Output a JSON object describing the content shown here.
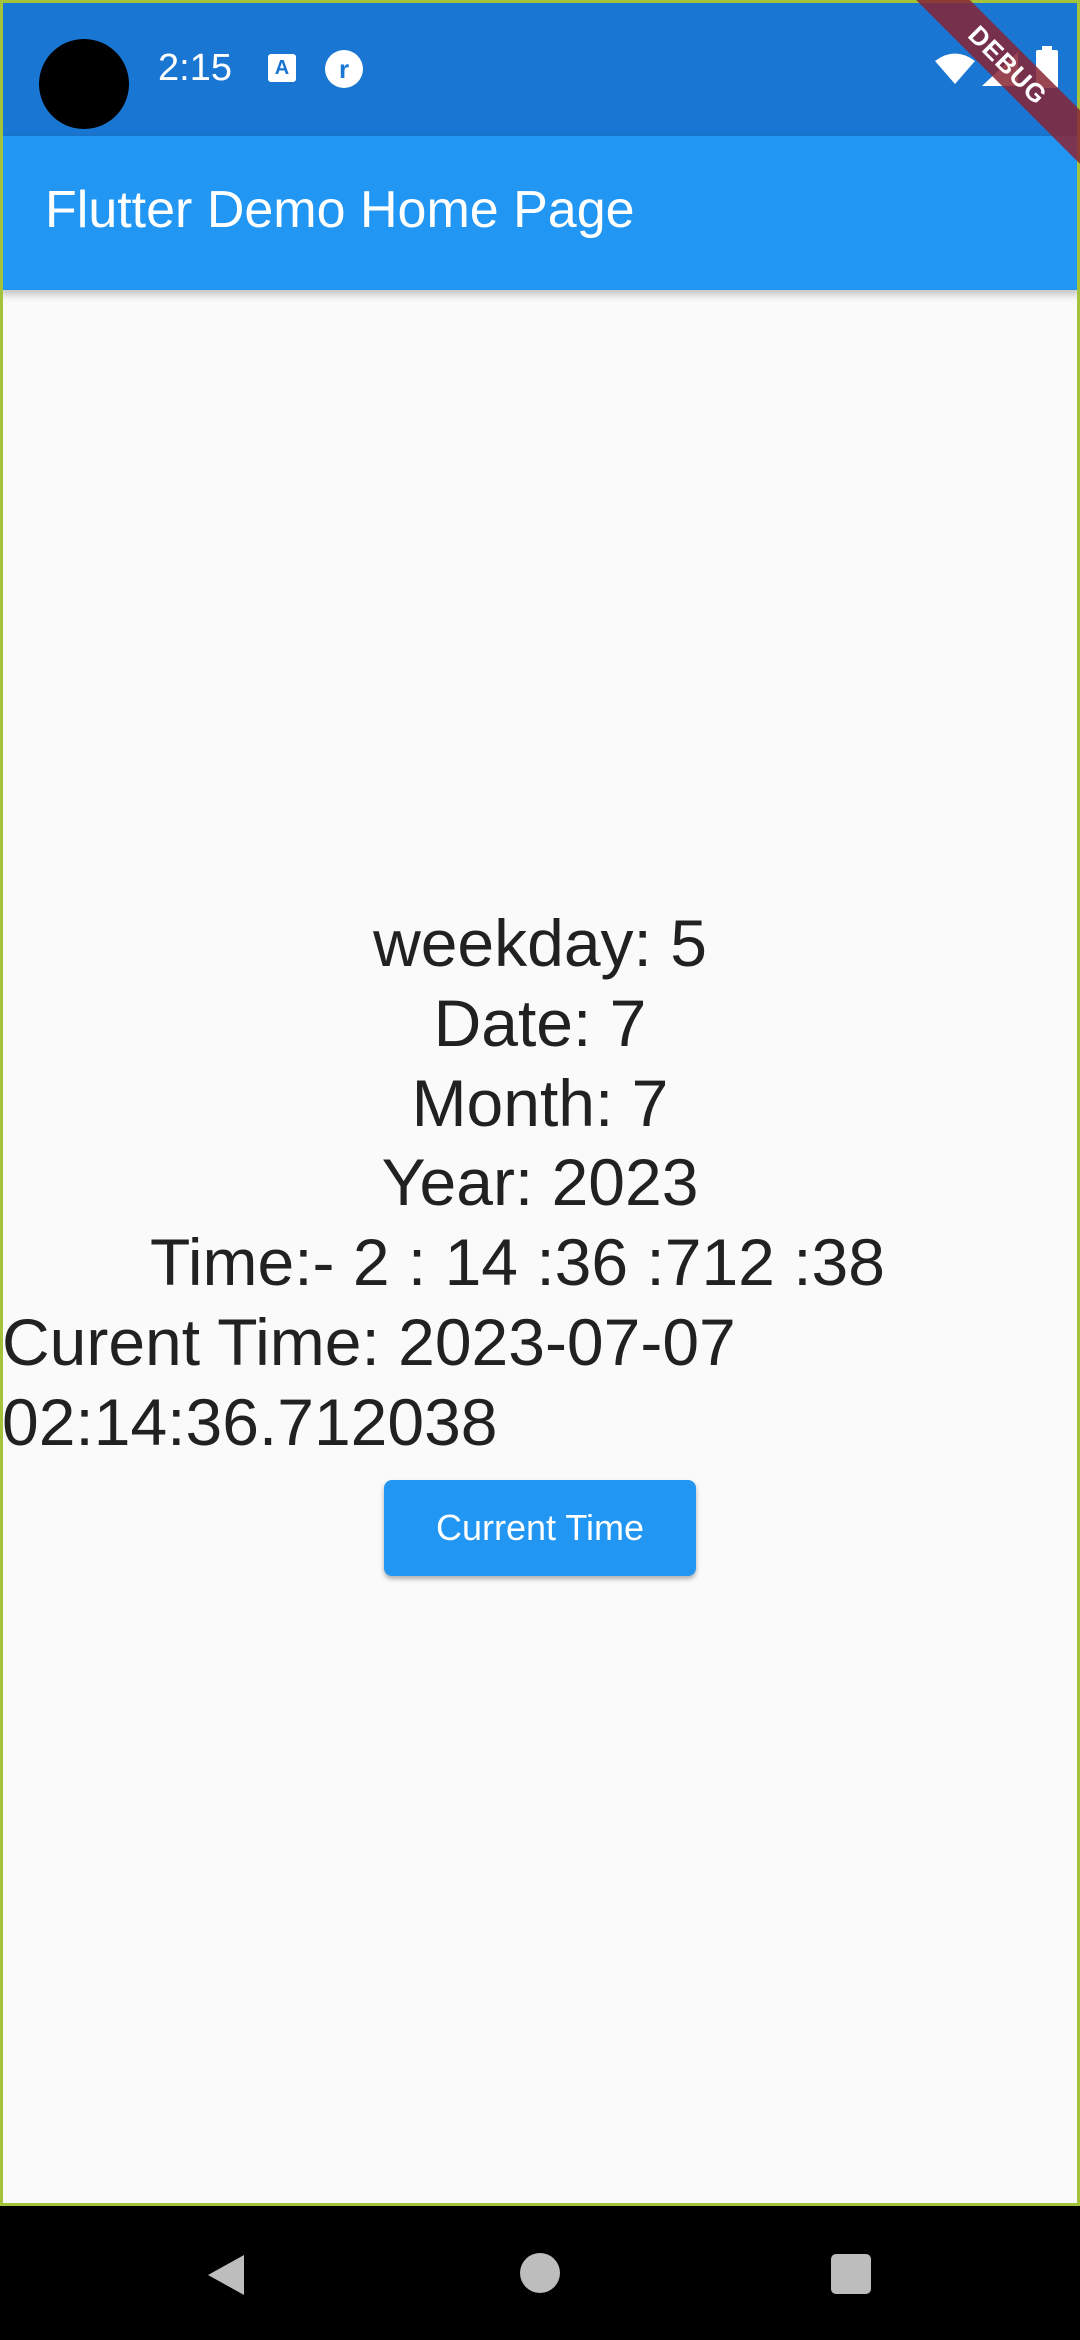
{
  "status_bar": {
    "time": "2:15",
    "icons": [
      "camera-cutout",
      "text-a-icon",
      "round-r-icon",
      "wifi-icon",
      "cell-signal-icon",
      "battery-icon"
    ]
  },
  "debug_banner": {
    "label": "DEBUG"
  },
  "app_bar": {
    "title": "Flutter Demo Home Page",
    "color": "#2196f3",
    "status_color": "#1976d2"
  },
  "main": {
    "weekday": "weekday: 5",
    "date": "Date: 7",
    "month": "Month: 7",
    "year": "Year: 2023",
    "time": "Time:- 2 : 14 :36 :712 :38",
    "current_time_line1": "Curent Time: 2023-07-07",
    "current_time_line2": "02:14:36.712038",
    "button_label": "Current Time"
  },
  "nav_bar": {
    "items": [
      "back-icon",
      "home-icon",
      "recents-icon"
    ]
  }
}
